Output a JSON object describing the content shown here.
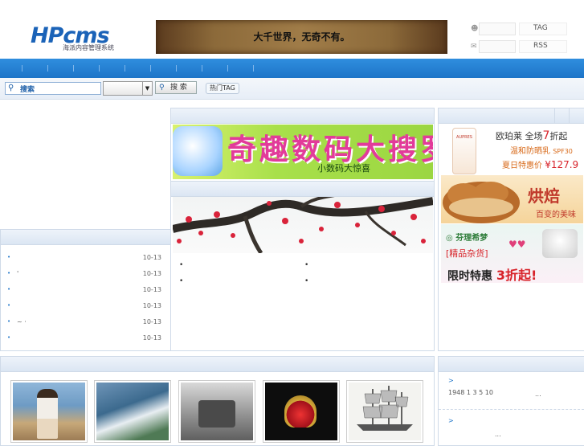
{
  "header": {
    "logo_brand": "HPcms",
    "logo_tagline": "海派内容管理系统",
    "banner_text": "大千世界，无奇不有。",
    "links": [
      {
        "icon": "user-icon",
        "label": ""
      },
      {
        "icon": "tag-icon",
        "label": "TAG"
      },
      {
        "icon": "mail-icon",
        "label": ""
      },
      {
        "icon": "rss-icon",
        "label": "RSS"
      }
    ]
  },
  "search": {
    "input_label": "搜索",
    "select_value": "",
    "button_label": "搜 索",
    "hot_tag_label": "热门TAG"
  },
  "left_list": [
    {
      "bullet": "•",
      "title": "",
      "date": "10-13"
    },
    {
      "bullet": "•",
      "title": "'",
      "date": "10-13"
    },
    {
      "bullet": "•",
      "title": "",
      "date": "10-13"
    },
    {
      "bullet": "•",
      "title": "",
      "date": "10-13"
    },
    {
      "bullet": "•",
      "title": "~ ·",
      "date": "10-13"
    },
    {
      "bullet": "•",
      "title": "",
      "date": "10-13"
    }
  ],
  "center": {
    "promo_title": "奇趣数码大搜罗",
    "promo_subtitle": "小数码大惊喜",
    "bullets": [
      "•",
      "•",
      "•",
      "•"
    ]
  },
  "ads": {
    "ad1": {
      "brand": "欧珀莱 全场",
      "discount": "7",
      "discount_suffix": "折起",
      "product": "温和防晒乳",
      "spf": "SPF30",
      "deal_label": "夏日特惠价",
      "price": "¥127.9",
      "bottle_label": "AUPRES"
    },
    "ad2": {
      "title": "烘焙",
      "subtitle": "百变的美味"
    },
    "ad3": {
      "brand": "芬理希梦",
      "category": "[精品杂货]",
      "promo": "限时特惠",
      "discount": "3折起!"
    }
  },
  "right_bottom": {
    "line1": "1948  1  3  5  10",
    "line1_suffix": "...",
    "line2": "...",
    "markers": [
      ">",
      ">"
    ]
  },
  "colors": {
    "nav_blue": "#1d74c8",
    "panel_header": "#dbe6f3",
    "ad_red": "#d8232a"
  }
}
